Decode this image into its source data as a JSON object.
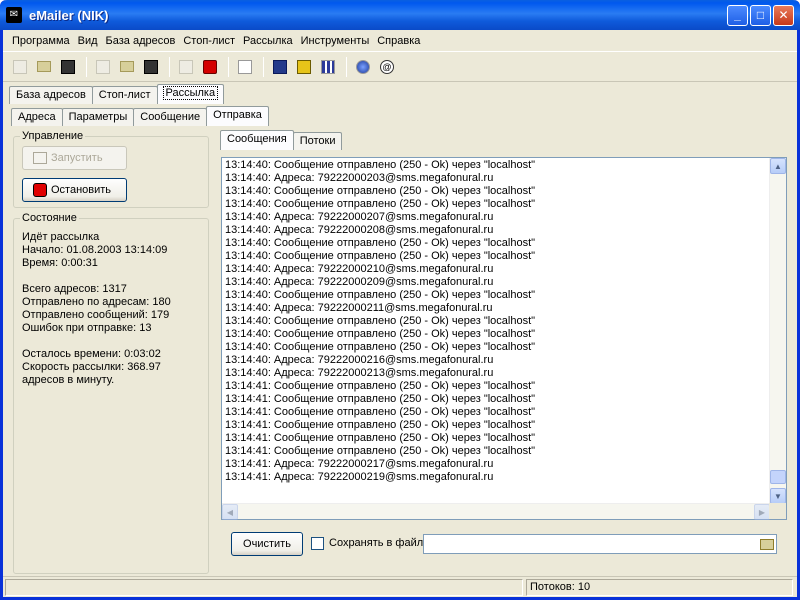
{
  "window": {
    "title": "eMailer (NIK)",
    "icon": "emailer-app-icon",
    "controls": {
      "minimize": "_",
      "maximize": "□",
      "close": "✕"
    }
  },
  "menu": [
    "Программа",
    "Вид",
    "База адресов",
    "Стоп-лист",
    "Рассылка",
    "Инструменты",
    "Справка"
  ],
  "toolbar": [
    {
      "icon": "new-doc-icon",
      "enabled": false
    },
    {
      "icon": "open-folder-icon",
      "enabled": false
    },
    {
      "icon": "save-icon",
      "enabled": false
    },
    {
      "sep": true
    },
    {
      "icon": "new-doc-icon",
      "enabled": false
    },
    {
      "icon": "open-folder-icon",
      "enabled": false
    },
    {
      "icon": "save-icon",
      "enabled": true
    },
    {
      "sep": true
    },
    {
      "icon": "start-icon",
      "enabled": false
    },
    {
      "icon": "stop-icon",
      "enabled": true
    },
    {
      "sep": true
    },
    {
      "icon": "settings-icon",
      "enabled": true
    },
    {
      "sep": true
    },
    {
      "icon": "book-icon",
      "enabled": true
    },
    {
      "icon": "film-icon",
      "enabled": true
    },
    {
      "icon": "grid-icon",
      "enabled": true
    },
    {
      "sep": true
    },
    {
      "icon": "globe-icon",
      "enabled": true
    },
    {
      "icon": "at-icon",
      "enabled": true
    }
  ],
  "main_tabs": [
    "База адресов",
    "Стоп-лист",
    "Рассылка"
  ],
  "main_tab_active": 2,
  "sub_tabs": [
    "Адреса",
    "Параметры",
    "Сообщение",
    "Отправка"
  ],
  "sub_tab_active": 3,
  "control": {
    "group_label": "Управление",
    "start_label": "Запустить",
    "stop_label": "Остановить"
  },
  "state": {
    "group_label": "Состояние",
    "lines": [
      "Идёт рассылка",
      "Начало: 01.08.2003 13:14:09",
      "Время: 0:00:31",
      "",
      "Всего адресов: 1317",
      "Отправлено по адресам: 180",
      "Отправлено сообщений: 179",
      "Ошибок при отправке: 13",
      "",
      "Осталось времени: 0:03:02",
      "Скорость рассылки: 368.97",
      "адресов в минуту."
    ]
  },
  "log_tabs": [
    "Сообщения",
    "Потоки"
  ],
  "log_tab_active": 0,
  "log": [
    "13:14:40: Сообщение отправлено (250 - Ok) через \"localhost\"",
    "13:14:40: Адреса: 79222000203@sms.megafonural.ru",
    "13:14:40: Сообщение отправлено (250 - Ok) через \"localhost\"",
    "13:14:40: Сообщение отправлено (250 - Ok) через \"localhost\"",
    "13:14:40: Адреса: 79222000207@sms.megafonural.ru",
    "13:14:40: Адреса: 79222000208@sms.megafonural.ru",
    "13:14:40: Сообщение отправлено (250 - Ok) через \"localhost\"",
    "13:14:40: Сообщение отправлено (250 - Ok) через \"localhost\"",
    "13:14:40: Адреса: 79222000210@sms.megafonural.ru",
    "13:14:40: Адреса: 79222000209@sms.megafonural.ru",
    "13:14:40: Сообщение отправлено (250 - Ok) через \"localhost\"",
    "13:14:40: Адреса: 79222000211@sms.megafonural.ru",
    "13:14:40: Сообщение отправлено (250 - Ok) через \"localhost\"",
    "13:14:40: Сообщение отправлено (250 - Ok) через \"localhost\"",
    "13:14:40: Сообщение отправлено (250 - Ok) через \"localhost\"",
    "13:14:40: Адреса: 79222000216@sms.megafonural.ru",
    "13:14:40: Адреса: 79222000213@sms.megafonural.ru",
    "13:14:41: Сообщение отправлено (250 - Ok) через \"localhost\"",
    "13:14:41: Сообщение отправлено (250 - Ok) через \"localhost\"",
    "13:14:41: Сообщение отправлено (250 - Ok) через \"localhost\"",
    "13:14:41: Сообщение отправлено (250 - Ok) через \"localhost\"",
    "13:14:41: Сообщение отправлено (250 - Ok) через \"localhost\"",
    "13:14:41: Сообщение отправлено (250 - Ok) через \"localhost\"",
    "13:14:41: Адреса: 79222000217@sms.megafonural.ru",
    "13:14:41: Адреса: 79222000219@sms.megafonural.ru"
  ],
  "bottom": {
    "clear_label": "Очистить",
    "save_checkbox_checked": false,
    "save_to_file_label": "Сохранять в файл:",
    "file_value": ""
  },
  "statusbar": {
    "left": "",
    "threads": "Потоков: 10"
  },
  "colors": {
    "accent": "#0831D9",
    "face": "#ECE9D8",
    "stop_red": "#E00000"
  }
}
